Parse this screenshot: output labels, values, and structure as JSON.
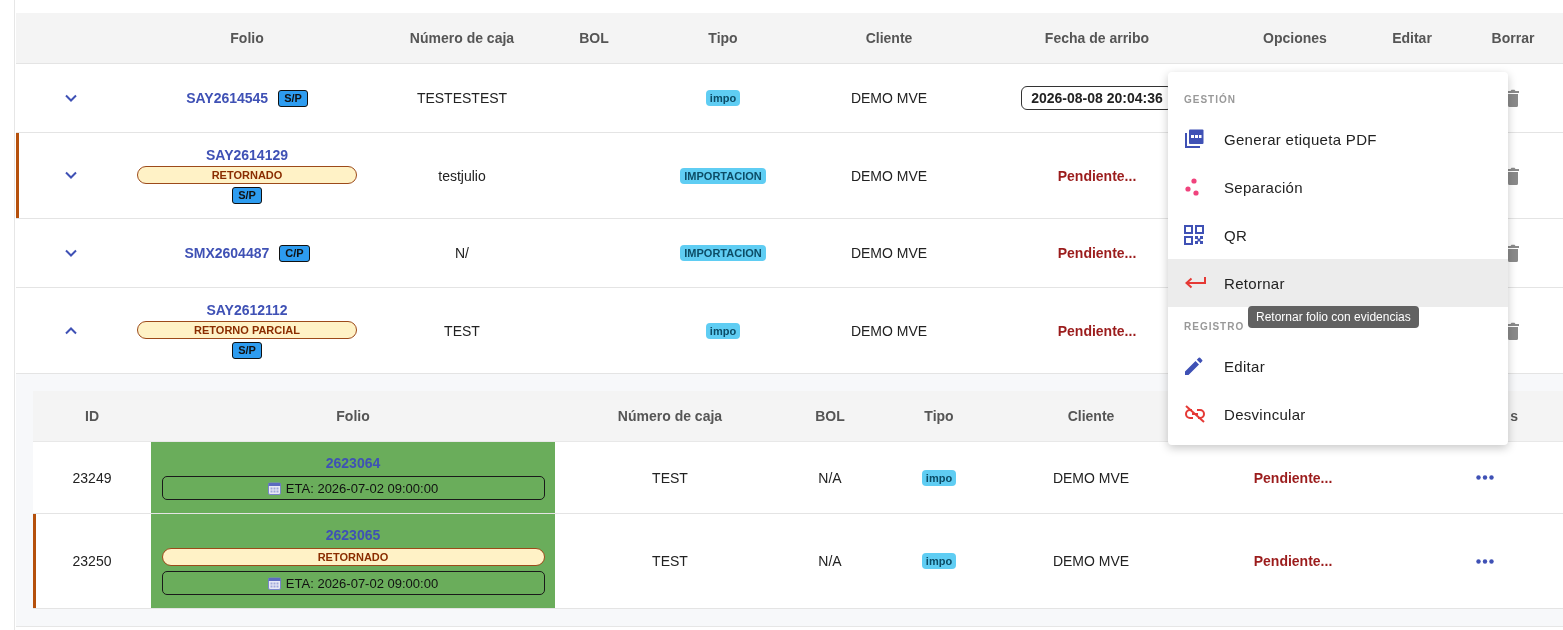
{
  "table": {
    "columns": [
      "Folio",
      "Número de caja",
      "BOL",
      "Tipo",
      "Cliente",
      "Fecha de arribo",
      "Opciones",
      "Editar",
      "Borrar"
    ],
    "rows": [
      {
        "expanded": false,
        "marked": false,
        "folio": "SAY2614545",
        "load": "S/P",
        "box_number": "TESTESTEST",
        "type": "impo",
        "client": "DEMO MVE",
        "arrival": {
          "kind": "date",
          "text": "2026-08-08 20:04:36"
        }
      },
      {
        "expanded": false,
        "marked": true,
        "folio": "SAY2614129",
        "status": "RETORNADO",
        "load": "S/P",
        "box_number": "testjulio",
        "type": "IMPORTACION",
        "client": "DEMO MVE",
        "arrival": {
          "kind": "pending",
          "text": "Pendiente..."
        }
      },
      {
        "expanded": false,
        "marked": false,
        "folio": "SMX2604487",
        "load": "C/P",
        "box_number": "N/",
        "type": "IMPORTACION",
        "client": "DEMO MVE",
        "arrival": {
          "kind": "pending",
          "text": "Pendiente..."
        }
      },
      {
        "expanded": true,
        "marked": false,
        "folio": "SAY2612112",
        "status": "RETORNO PARCIAL",
        "load": "S/P",
        "box_number": "TEST",
        "type": "impo",
        "client": "DEMO MVE",
        "arrival": {
          "kind": "pending",
          "text": "Pendiente..."
        },
        "sub_table": {
          "columns": [
            "ID",
            "Folio",
            "Número de caja",
            "BOL",
            "Tipo",
            "Cliente",
            "s"
          ],
          "rows": [
            {
              "marked": false,
              "id": "23249",
              "folio": "2623064",
              "eta": "ETA: 2026-07-02 09:00:00",
              "box_number": "TEST",
              "bol": "N/A",
              "type": "impo",
              "client": "DEMO MVE",
              "arrival": "Pendiente..."
            },
            {
              "marked": true,
              "id": "23250",
              "folio": "2623065",
              "status": "RETORNADO",
              "eta": "ETA: 2026-07-02 09:00:00",
              "box_number": "TEST",
              "bol": "N/A",
              "type": "impo",
              "client": "DEMO MVE",
              "arrival": "Pendiente..."
            }
          ]
        }
      }
    ]
  },
  "options_menu": {
    "sections": [
      {
        "title": "GESTIÓN",
        "items": [
          {
            "kind": "pdf",
            "label": "Generar etiqueta PDF",
            "selected": false
          },
          {
            "kind": "dots",
            "label": "Separación",
            "selected": false
          },
          {
            "kind": "qr",
            "label": "QR",
            "selected": false
          },
          {
            "kind": "return",
            "label": "Retornar",
            "selected": true
          }
        ]
      },
      {
        "title": "REGISTRO",
        "items": [
          {
            "kind": "edit",
            "label": "Editar",
            "selected": false
          },
          {
            "kind": "unlink",
            "label": "Desvincular",
            "selected": false
          }
        ]
      }
    ]
  },
  "tooltip": {
    "text": "Retornar folio con evidencias"
  }
}
